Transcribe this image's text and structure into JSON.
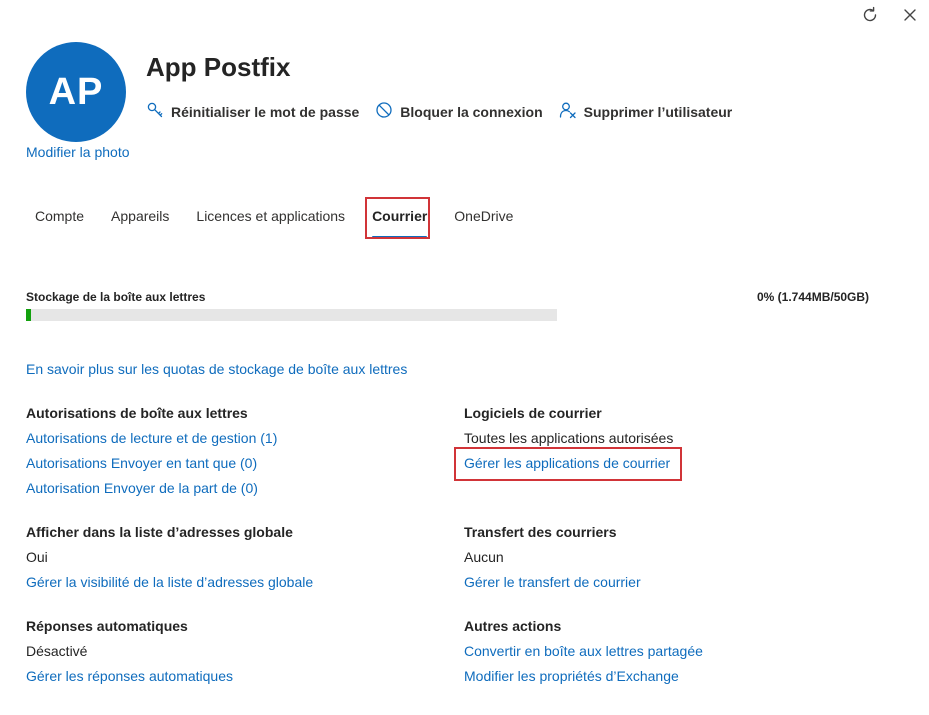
{
  "window": {
    "refresh_icon": "refresh-icon",
    "close_icon": "close-icon"
  },
  "user": {
    "initials": "AP",
    "name": "App Postfix",
    "change_photo": "Modifier la photo",
    "avatar_color": "#0f6cbd"
  },
  "actions": [
    {
      "label": "Réinitialiser le mot de passe",
      "icon": "key-icon"
    },
    {
      "label": "Bloquer la connexion",
      "icon": "block-icon"
    },
    {
      "label": "Supprimer l’utilisateur",
      "icon": "delete-user-icon"
    }
  ],
  "tabs": [
    {
      "label": "Compte",
      "active": false
    },
    {
      "label": "Appareils",
      "active": false
    },
    {
      "label": "Licences et applications",
      "active": false
    },
    {
      "label": "Courrier",
      "active": true
    },
    {
      "label": "OneDrive",
      "active": false
    }
  ],
  "storage": {
    "label": "Stockage de la boîte aux lettres",
    "value_text": "0% (1.744MB/50GB)",
    "fraction": 3e-05,
    "fill_color": "#13a10e"
  },
  "quota_link": "En savoir plus sur les quotas de stockage de boîte aux lettres",
  "sections": {
    "mailbox_permissions": {
      "heading": "Autorisations de boîte aux lettres",
      "links": [
        "Autorisations de lecture et de gestion (1)",
        "Autorisations Envoyer en tant que (0)",
        "Autorisation Envoyer de la part de (0)"
      ]
    },
    "email_apps": {
      "heading": "Logiciels de courrier",
      "value": "Toutes les applications autorisées",
      "link": "Gérer les applications de courrier"
    },
    "gal": {
      "heading": "Afficher dans la liste d’adresses globale",
      "value": "Oui",
      "link": "Gérer la visibilité de la liste d’adresses globale"
    },
    "forwarding": {
      "heading": "Transfert des courriers",
      "value": "Aucun",
      "link": "Gérer le transfert de courrier"
    },
    "auto_replies": {
      "heading": "Réponses automatiques",
      "value": "Désactivé",
      "link": "Gérer les réponses automatiques"
    },
    "other_actions": {
      "heading": "Autres actions",
      "links": [
        "Convertir en boîte aux lettres partagée",
        "Modifier les propriétés d’Exchange"
      ]
    }
  },
  "colors": {
    "link": "#0f6cbd",
    "highlight": "#d13438"
  }
}
